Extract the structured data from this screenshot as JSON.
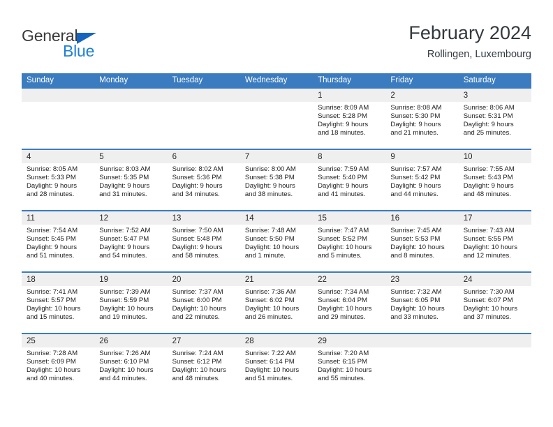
{
  "brand": {
    "name_part1": "General",
    "name_part2": "Blue",
    "accent_color": "#1e7fd4",
    "triangle_color": "#1565c0"
  },
  "header": {
    "month_title": "February 2024",
    "location": "Rollingen, Luxembourg"
  },
  "theme": {
    "header_row_bg": "#3b7cc0",
    "day_band_bg": "#efefef",
    "divider_color": "#3b7cc0"
  },
  "weekdays": [
    "Sunday",
    "Monday",
    "Tuesday",
    "Wednesday",
    "Thursday",
    "Friday",
    "Saturday"
  ],
  "weeks": [
    [
      {
        "day": "",
        "sunrise": "",
        "sunset": "",
        "daylight_line1": "",
        "daylight_line2": ""
      },
      {
        "day": "",
        "sunrise": "",
        "sunset": "",
        "daylight_line1": "",
        "daylight_line2": ""
      },
      {
        "day": "",
        "sunrise": "",
        "sunset": "",
        "daylight_line1": "",
        "daylight_line2": ""
      },
      {
        "day": "",
        "sunrise": "",
        "sunset": "",
        "daylight_line1": "",
        "daylight_line2": ""
      },
      {
        "day": "1",
        "sunrise": "Sunrise: 8:09 AM",
        "sunset": "Sunset: 5:28 PM",
        "daylight_line1": "Daylight: 9 hours",
        "daylight_line2": "and 18 minutes."
      },
      {
        "day": "2",
        "sunrise": "Sunrise: 8:08 AM",
        "sunset": "Sunset: 5:30 PM",
        "daylight_line1": "Daylight: 9 hours",
        "daylight_line2": "and 21 minutes."
      },
      {
        "day": "3",
        "sunrise": "Sunrise: 8:06 AM",
        "sunset": "Sunset: 5:31 PM",
        "daylight_line1": "Daylight: 9 hours",
        "daylight_line2": "and 25 minutes."
      }
    ],
    [
      {
        "day": "4",
        "sunrise": "Sunrise: 8:05 AM",
        "sunset": "Sunset: 5:33 PM",
        "daylight_line1": "Daylight: 9 hours",
        "daylight_line2": "and 28 minutes."
      },
      {
        "day": "5",
        "sunrise": "Sunrise: 8:03 AM",
        "sunset": "Sunset: 5:35 PM",
        "daylight_line1": "Daylight: 9 hours",
        "daylight_line2": "and 31 minutes."
      },
      {
        "day": "6",
        "sunrise": "Sunrise: 8:02 AM",
        "sunset": "Sunset: 5:36 PM",
        "daylight_line1": "Daylight: 9 hours",
        "daylight_line2": "and 34 minutes."
      },
      {
        "day": "7",
        "sunrise": "Sunrise: 8:00 AM",
        "sunset": "Sunset: 5:38 PM",
        "daylight_line1": "Daylight: 9 hours",
        "daylight_line2": "and 38 minutes."
      },
      {
        "day": "8",
        "sunrise": "Sunrise: 7:59 AM",
        "sunset": "Sunset: 5:40 PM",
        "daylight_line1": "Daylight: 9 hours",
        "daylight_line2": "and 41 minutes."
      },
      {
        "day": "9",
        "sunrise": "Sunrise: 7:57 AM",
        "sunset": "Sunset: 5:42 PM",
        "daylight_line1": "Daylight: 9 hours",
        "daylight_line2": "and 44 minutes."
      },
      {
        "day": "10",
        "sunrise": "Sunrise: 7:55 AM",
        "sunset": "Sunset: 5:43 PM",
        "daylight_line1": "Daylight: 9 hours",
        "daylight_line2": "and 48 minutes."
      }
    ],
    [
      {
        "day": "11",
        "sunrise": "Sunrise: 7:54 AM",
        "sunset": "Sunset: 5:45 PM",
        "daylight_line1": "Daylight: 9 hours",
        "daylight_line2": "and 51 minutes."
      },
      {
        "day": "12",
        "sunrise": "Sunrise: 7:52 AM",
        "sunset": "Sunset: 5:47 PM",
        "daylight_line1": "Daylight: 9 hours",
        "daylight_line2": "and 54 minutes."
      },
      {
        "day": "13",
        "sunrise": "Sunrise: 7:50 AM",
        "sunset": "Sunset: 5:48 PM",
        "daylight_line1": "Daylight: 9 hours",
        "daylight_line2": "and 58 minutes."
      },
      {
        "day": "14",
        "sunrise": "Sunrise: 7:48 AM",
        "sunset": "Sunset: 5:50 PM",
        "daylight_line1": "Daylight: 10 hours",
        "daylight_line2": "and 1 minute."
      },
      {
        "day": "15",
        "sunrise": "Sunrise: 7:47 AM",
        "sunset": "Sunset: 5:52 PM",
        "daylight_line1": "Daylight: 10 hours",
        "daylight_line2": "and 5 minutes."
      },
      {
        "day": "16",
        "sunrise": "Sunrise: 7:45 AM",
        "sunset": "Sunset: 5:53 PM",
        "daylight_line1": "Daylight: 10 hours",
        "daylight_line2": "and 8 minutes."
      },
      {
        "day": "17",
        "sunrise": "Sunrise: 7:43 AM",
        "sunset": "Sunset: 5:55 PM",
        "daylight_line1": "Daylight: 10 hours",
        "daylight_line2": "and 12 minutes."
      }
    ],
    [
      {
        "day": "18",
        "sunrise": "Sunrise: 7:41 AM",
        "sunset": "Sunset: 5:57 PM",
        "daylight_line1": "Daylight: 10 hours",
        "daylight_line2": "and 15 minutes."
      },
      {
        "day": "19",
        "sunrise": "Sunrise: 7:39 AM",
        "sunset": "Sunset: 5:59 PM",
        "daylight_line1": "Daylight: 10 hours",
        "daylight_line2": "and 19 minutes."
      },
      {
        "day": "20",
        "sunrise": "Sunrise: 7:37 AM",
        "sunset": "Sunset: 6:00 PM",
        "daylight_line1": "Daylight: 10 hours",
        "daylight_line2": "and 22 minutes."
      },
      {
        "day": "21",
        "sunrise": "Sunrise: 7:36 AM",
        "sunset": "Sunset: 6:02 PM",
        "daylight_line1": "Daylight: 10 hours",
        "daylight_line2": "and 26 minutes."
      },
      {
        "day": "22",
        "sunrise": "Sunrise: 7:34 AM",
        "sunset": "Sunset: 6:04 PM",
        "daylight_line1": "Daylight: 10 hours",
        "daylight_line2": "and 29 minutes."
      },
      {
        "day": "23",
        "sunrise": "Sunrise: 7:32 AM",
        "sunset": "Sunset: 6:05 PM",
        "daylight_line1": "Daylight: 10 hours",
        "daylight_line2": "and 33 minutes."
      },
      {
        "day": "24",
        "sunrise": "Sunrise: 7:30 AM",
        "sunset": "Sunset: 6:07 PM",
        "daylight_line1": "Daylight: 10 hours",
        "daylight_line2": "and 37 minutes."
      }
    ],
    [
      {
        "day": "25",
        "sunrise": "Sunrise: 7:28 AM",
        "sunset": "Sunset: 6:09 PM",
        "daylight_line1": "Daylight: 10 hours",
        "daylight_line2": "and 40 minutes."
      },
      {
        "day": "26",
        "sunrise": "Sunrise: 7:26 AM",
        "sunset": "Sunset: 6:10 PM",
        "daylight_line1": "Daylight: 10 hours",
        "daylight_line2": "and 44 minutes."
      },
      {
        "day": "27",
        "sunrise": "Sunrise: 7:24 AM",
        "sunset": "Sunset: 6:12 PM",
        "daylight_line1": "Daylight: 10 hours",
        "daylight_line2": "and 48 minutes."
      },
      {
        "day": "28",
        "sunrise": "Sunrise: 7:22 AM",
        "sunset": "Sunset: 6:14 PM",
        "daylight_line1": "Daylight: 10 hours",
        "daylight_line2": "and 51 minutes."
      },
      {
        "day": "29",
        "sunrise": "Sunrise: 7:20 AM",
        "sunset": "Sunset: 6:15 PM",
        "daylight_line1": "Daylight: 10 hours",
        "daylight_line2": "and 55 minutes."
      },
      {
        "day": "",
        "sunrise": "",
        "sunset": "",
        "daylight_line1": "",
        "daylight_line2": ""
      },
      {
        "day": "",
        "sunrise": "",
        "sunset": "",
        "daylight_line1": "",
        "daylight_line2": ""
      }
    ]
  ]
}
